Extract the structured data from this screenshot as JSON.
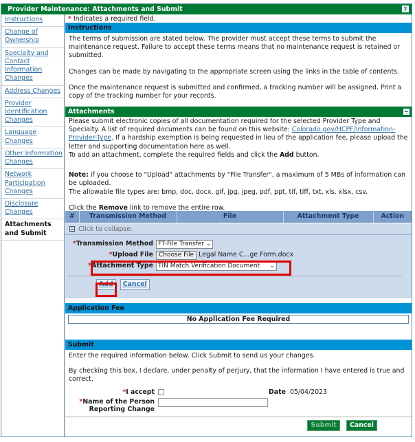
{
  "window": {
    "title": "Provider Maintenance: Attachments and Submit",
    "help_icon": "?"
  },
  "sidebar": {
    "items": [
      {
        "label": "Instructions",
        "active": false
      },
      {
        "label": "Change of Ownership",
        "active": false
      },
      {
        "label": "Specialty and Contact Information Changes",
        "active": false
      },
      {
        "label": "Address Changes",
        "active": false
      },
      {
        "label": "Provider Identification Changes",
        "active": false
      },
      {
        "label": "Language Changes",
        "active": false
      },
      {
        "label": "Other Information Changes",
        "active": false
      },
      {
        "label": "Network Participation Changes",
        "active": false
      },
      {
        "label": "Disclosure Changes",
        "active": false
      },
      {
        "label": "Attachments and Submit",
        "active": true
      }
    ]
  },
  "required_note": {
    "star": "*",
    "text": " Indicates a required field."
  },
  "instructions": {
    "heading": "Instructions",
    "paragraphs": [
      "The terms of submission are stated below. The provider must accept these terms to submit the maintenance request. Failure to accept these terms means that no maintenance request is retained or submitted.",
      "Changes can be made by navigating to the appropriate screen using the links in the table of contents.",
      "Once the maintenance request is submitted and confirmed, a tracking number will be assigned. Print a copy of the tracking number for your records."
    ]
  },
  "attachments": {
    "heading": "Attachments",
    "intro_before_link": "Please submit electronic copies of all documentation required for the selected Provider Type and Specialty. A list of required documents can be found on this website: ",
    "link_text": "Colorado.gov/HCPF/Information-Provider-Type",
    "intro_after_link": ". If a hardship exemption is being requested in lieu of the application fee, please upload the letter and supporting documentation here as well.",
    "add_instr_before": "To add an attachment, complete the required fields and click the ",
    "add_instr_bold": "Add",
    "add_instr_after": " button.",
    "note_label": "Note:",
    "note_text": " if you choose to \"Upload\" attachments by \"File Transfer\", a maximum of 5 MBs of information can be uploaded.",
    "file_types": "The allowable file types are: bmp, doc, docx, gif, jpg, jpeg, pdf, ppt, tif, tiff, txt, xls, xlsx, csv.",
    "remove_before": "Click the ",
    "remove_bold": "Remove",
    "remove_after": " link to remove the entire row.",
    "table_headers": [
      "#",
      "Transmission Method",
      "File",
      "Attachment Type",
      "Action"
    ],
    "collapse_text": "Click to collapse.",
    "form": {
      "transmission_label": "Transmission Method",
      "transmission_value": "FT-File Transfer",
      "upload_label": "Upload File",
      "choose_file_label": "Choose File",
      "file_name": "Legal Name C...ge Form.docx",
      "attachment_type_label": "Attachment Type",
      "attachment_type_value": "TIN Match Verification Document",
      "add_label": "Add",
      "cancel_label": "Cancel"
    }
  },
  "application_fee": {
    "heading": "Application Fee",
    "text": "No Application Fee Required"
  },
  "submit": {
    "heading": "Submit",
    "instruction": "Enter the required information below. Click Submit to send us your changes.",
    "declaration": "By checking this box, I declare, under penalty of perjury, that the information I have entered is true and correct.",
    "accept_label": "I accept",
    "accept_checked": false,
    "date_label": "Date",
    "date_value": "05/04/2023",
    "name_label_line1": "Name of the Person",
    "name_label_line2": "Reporting Change",
    "name_value": "",
    "submit_label": "Submit",
    "cancel_label": "Cancel"
  },
  "colors": {
    "title_green": "#007a33",
    "section_blue": "#0093d8",
    "highlight_red": "#e00000",
    "link_blue": "#2d6ea8"
  }
}
